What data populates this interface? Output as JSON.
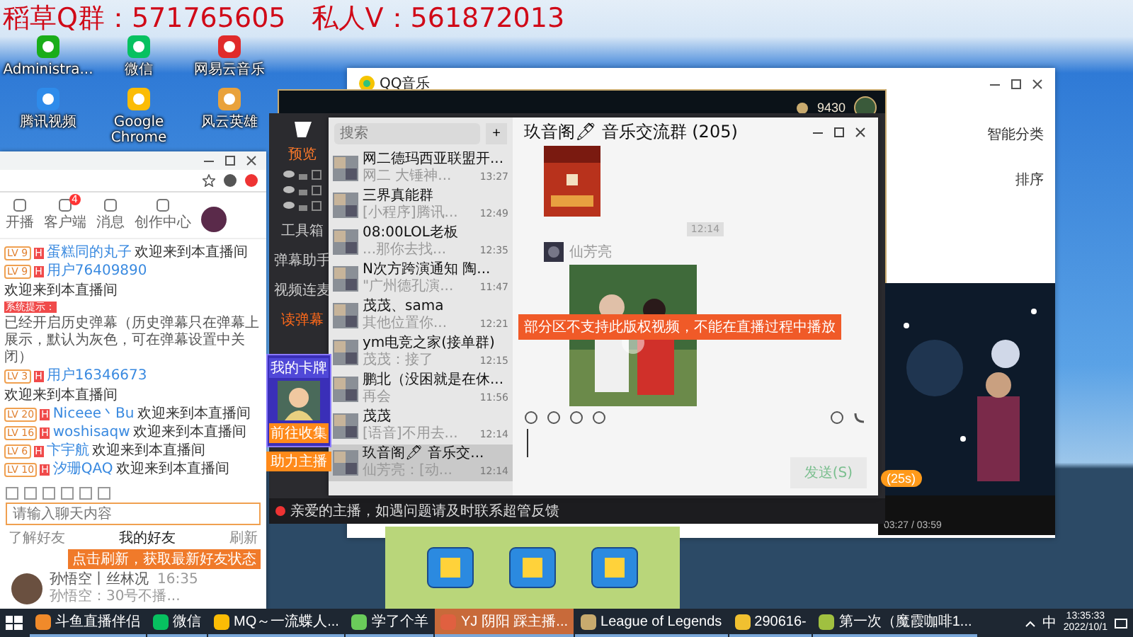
{
  "overlay": {
    "group": "稻草Q群：571765605",
    "private": "私人V：561872013"
  },
  "desktop_icons": [
    {
      "label": "Administra..."
    },
    {
      "label": "微信"
    },
    {
      "label": "网易云音乐"
    },
    {
      "label": "腾讯视频"
    },
    {
      "label": "Google Chrome"
    },
    {
      "label": "风云英雄"
    }
  ],
  "music_window": {
    "title": "QQ音乐",
    "smart_sort": "智能分类",
    "sort": "排序"
  },
  "lol_client": {
    "currency": "9430"
  },
  "stream_tool": {
    "tab": "预览",
    "tools": [
      {
        "label": "工具箱",
        "selected": false
      },
      {
        "label": "弹幕助手",
        "selected": false
      },
      {
        "label": "视频连麦",
        "selected": false
      },
      {
        "label": "读弹幕",
        "selected": true
      }
    ],
    "notice": "亲爱的主播，如遇问题请及时联系超管反馈"
  },
  "wechat": {
    "search": {
      "placeholder": "搜索"
    },
    "add": "+",
    "chats": [
      {
        "name": "网二德玛西亚联盟开...",
        "time": "13:27",
        "preview": "网二 大锤神...",
        "selected": false
      },
      {
        "name": "三界真能群",
        "time": "12:49",
        "preview": "[小程序]腾讯...",
        "selected": false
      },
      {
        "name": "08:00LOL老板",
        "time": "12:35",
        "preview": "...那你去找...",
        "selected": false
      },
      {
        "name": "N次方跨演通知 陶...",
        "time": "11:47",
        "preview": "\"广州德孔演...",
        "selected": false
      },
      {
        "name": "茂茂、sama",
        "time": "12:21",
        "preview": "其他位置你...",
        "selected": false
      },
      {
        "name": "ym电竞之家(接单群)",
        "time": "12:15",
        "preview": "茂茂：接了",
        "selected": false
      },
      {
        "name": "鹏北（没困就是在休...",
        "time": "11:56",
        "preview": "再会",
        "selected": false
      },
      {
        "name": "茂茂",
        "time": "12:14",
        "preview": "[语音]不用去...",
        "selected": false
      },
      {
        "name": "玖音阁🖊 音乐交...",
        "time": "12:14",
        "preview": "仙芳亮：[动...",
        "selected": true
      }
    ],
    "title": "玖音阁🖊 音乐交流群 (205)",
    "time_divider": "12:14",
    "sender": "仙芳亮",
    "send": "发送(S)"
  },
  "stream_warning": "部分区不支持此版权视频，不能在直播过程中播放",
  "gift_timer": "(25s)",
  "browser": {
    "nav": [
      {
        "label": "开播"
      },
      {
        "label": "客户端",
        "badge": "4"
      },
      {
        "label": "消息"
      },
      {
        "label": "创作中心"
      }
    ],
    "messages": [
      {
        "kind": "user",
        "level": "LV 9",
        "badge": "H",
        "user": "蛋糕同的丸子",
        "text": "欢迎来到本直播间"
      },
      {
        "kind": "user",
        "level": "LV 9",
        "badge": "H",
        "user": "用户76409890",
        "text": "欢迎来到本直播间"
      },
      {
        "kind": "system",
        "user": "系统提示：",
        "text": "已经开启历史弹幕（历史弹幕只在弹幕上展示，默认为灰色，可在弹幕设置中关闭）"
      },
      {
        "kind": "user",
        "level": "LV 3",
        "badge": "H",
        "user": "用户16346673",
        "text": "欢迎来到本直播间"
      },
      {
        "kind": "user",
        "level": "LV 20",
        "badge": "H",
        "user": "Niceee丶Bu",
        "text": "欢迎来到本直播间"
      },
      {
        "kind": "user",
        "level": "LV 16",
        "badge": "H",
        "user": "woshisaqw",
        "text": "欢迎来到本直播间"
      },
      {
        "kind": "user",
        "level": "LV 6",
        "badge": "H",
        "user": "卞宇航",
        "text": "欢迎来到本直播间"
      },
      {
        "kind": "user",
        "level": "LV 10",
        "badge": "H",
        "user": "汐珊QAQ",
        "text": "欢迎来到本直播间"
      }
    ],
    "input": {
      "placeholder": "请输入聊天内容"
    },
    "friend_tabs": [
      {
        "label": "了解好友",
        "selected": false
      },
      {
        "label": "我的好友",
        "selected": true
      }
    ],
    "refresh": "刷新",
    "tooltip": "点击刷新，获取最新好友状态",
    "friends": [
      {
        "name": "孙悟空丨丝林况",
        "status": "孙悟空：30号不播...",
        "time": "16:35"
      }
    ]
  },
  "card_widget": {
    "title": "我的卡牌",
    "button": "前往收集",
    "boost": "助力主播"
  },
  "player": {
    "time": "03:27 / 03:59"
  },
  "taskbar": {
    "items": [
      {
        "label": "斗鱼直播伴侣",
        "selected": false
      },
      {
        "label": "微信",
        "selected": false
      },
      {
        "label": "MQ～一流蝶人...",
        "selected": false
      },
      {
        "label": "学了个羊",
        "selected": false
      },
      {
        "label": "YJ 阴阳 踩主播...",
        "selected": true
      },
      {
        "label": "League of Legends",
        "selected": false
      },
      {
        "label": "290616-",
        "selected": false
      },
      {
        "label": "第一次（魔霞咖啡1...",
        "selected": false
      }
    ],
    "ime": "中",
    "time": "13:35:33",
    "date": "2022/10/1"
  }
}
